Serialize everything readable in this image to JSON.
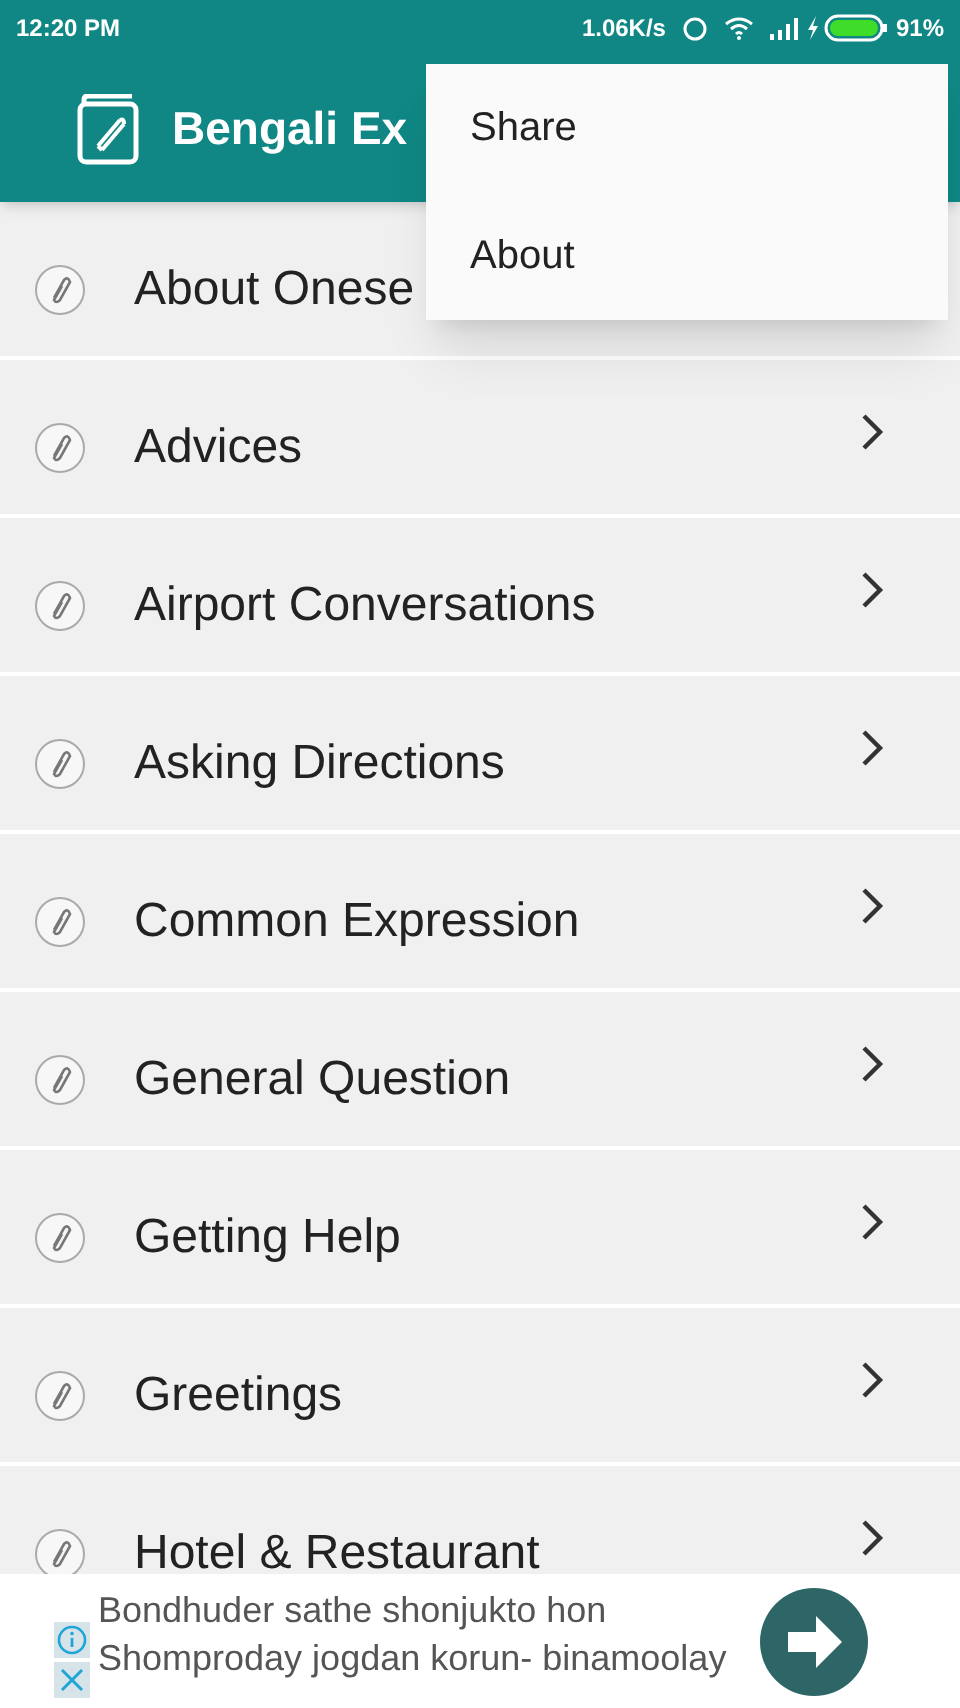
{
  "status_bar": {
    "time": "12:20 PM",
    "speed": "1.06K/s",
    "battery": "91%"
  },
  "app_bar": {
    "title": "Bengali Ex"
  },
  "menu": {
    "items": [
      {
        "label": "Share"
      },
      {
        "label": "About"
      }
    ]
  },
  "list": [
    {
      "label": "About Onese",
      "chevron": false
    },
    {
      "label": "Advices",
      "chevron": true
    },
    {
      "label": "Airport Conversations",
      "chevron": true
    },
    {
      "label": "Asking Directions",
      "chevron": true
    },
    {
      "label": "Common Expression",
      "chevron": true
    },
    {
      "label": "General Question",
      "chevron": true
    },
    {
      "label": "Getting Help",
      "chevron": true
    },
    {
      "label": "Greetings",
      "chevron": true
    },
    {
      "label": "Hotel & Restaurant",
      "chevron": true
    }
  ],
  "ad": {
    "lines": [
      "Bondhuder sathe shonjukto hon",
      "Shomproday jogdan korun- binamoolay"
    ]
  }
}
